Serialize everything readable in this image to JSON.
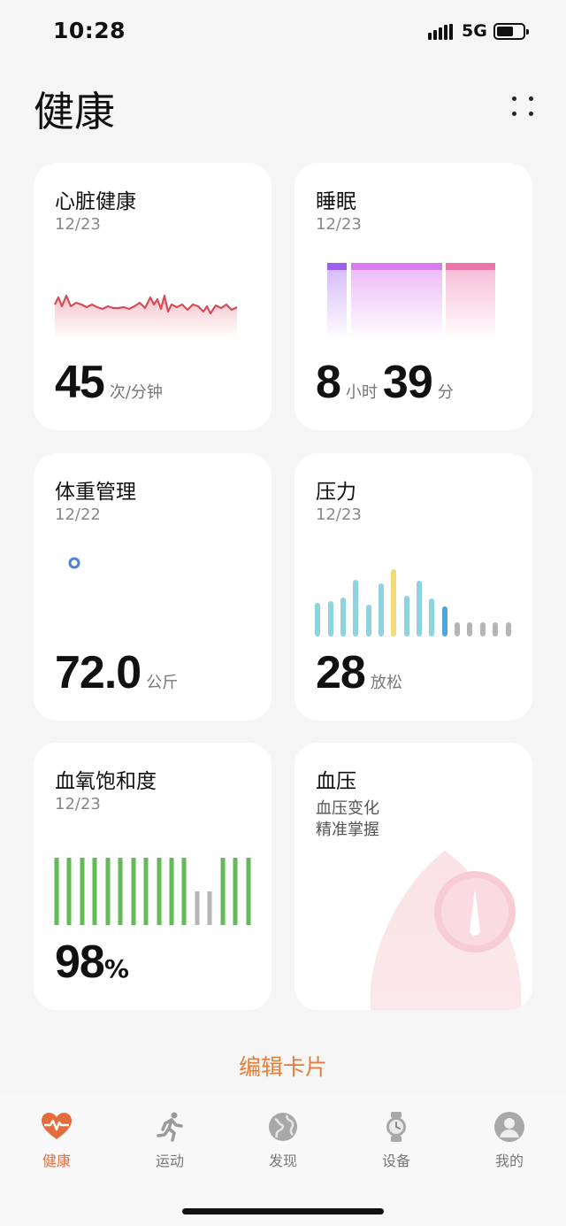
{
  "status": {
    "time": "10:28",
    "network": "5G"
  },
  "header": {
    "title": "健康"
  },
  "cards": {
    "heart": {
      "title": "心脏健康",
      "date": "12/23",
      "value": "45",
      "unit": "次/分钟"
    },
    "sleep": {
      "title": "睡眠",
      "date": "12/23",
      "hours": "8",
      "hours_unit": "小时",
      "minutes": "39",
      "minutes_unit": "分"
    },
    "weight": {
      "title": "体重管理",
      "date": "12/22",
      "value": "72.0",
      "unit": "公斤"
    },
    "stress": {
      "title": "压力",
      "date": "12/23",
      "value": "28",
      "unit": "放松"
    },
    "spo2": {
      "title": "血氧饱和度",
      "date": "12/23",
      "value": "98",
      "unit": "%"
    },
    "bp": {
      "title": "血压",
      "line1": "血压变化",
      "line2": "精准掌握"
    }
  },
  "edit_label": "编辑卡片",
  "nav": [
    {
      "label": "健康",
      "icon": "heart-pulse-icon",
      "active": true
    },
    {
      "label": "运动",
      "icon": "running-icon",
      "active": false
    },
    {
      "label": "发现",
      "icon": "globe-icon",
      "active": false
    },
    {
      "label": "设备",
      "icon": "watch-icon",
      "active": false
    },
    {
      "label": "我的",
      "icon": "person-icon",
      "active": false
    }
  ],
  "colors": {
    "accent": "#e46d3d",
    "heart_line": "#d94a5a",
    "sleep_deep": "#9d5ff0",
    "sleep_light": "#d97cf0",
    "sleep_rem": "#ef74a8",
    "stress_bar": "#8fd3e0",
    "stress_peak": "#f2dc7a",
    "stress_now": "#4fa7dc",
    "spo2_bar": "#63bb57"
  }
}
